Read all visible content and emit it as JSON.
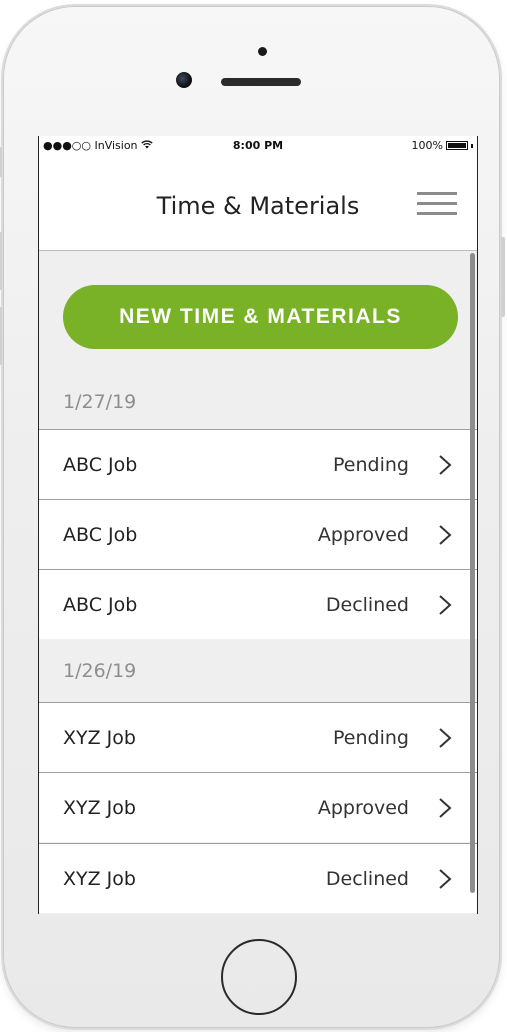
{
  "statusbar": {
    "carrier": "●●●○○ InVision",
    "time": "8:00 PM",
    "battery": "100%",
    "battery_level": 1.0
  },
  "header": {
    "title": "Time & Materials",
    "menu_icon": "hamburger-menu-icon"
  },
  "primary_action": {
    "label": "NEW TIME & MATERIALS",
    "color": "#79b127"
  },
  "sections": [
    {
      "date": "1/27/19",
      "items": [
        {
          "job": "ABC Job",
          "status": "Pending"
        },
        {
          "job": "ABC Job",
          "status": "Approved"
        },
        {
          "job": "ABC Job",
          "status": "Declined"
        }
      ]
    },
    {
      "date": "1/26/19",
      "items": [
        {
          "job": "XYZ Job",
          "status": "Pending"
        },
        {
          "job": "XYZ Job",
          "status": "Approved"
        },
        {
          "job": "XYZ Job",
          "status": "Declined"
        }
      ]
    }
  ],
  "icons": {
    "row_chevron": "chevron-right-icon",
    "wifi": "wifi-icon"
  }
}
